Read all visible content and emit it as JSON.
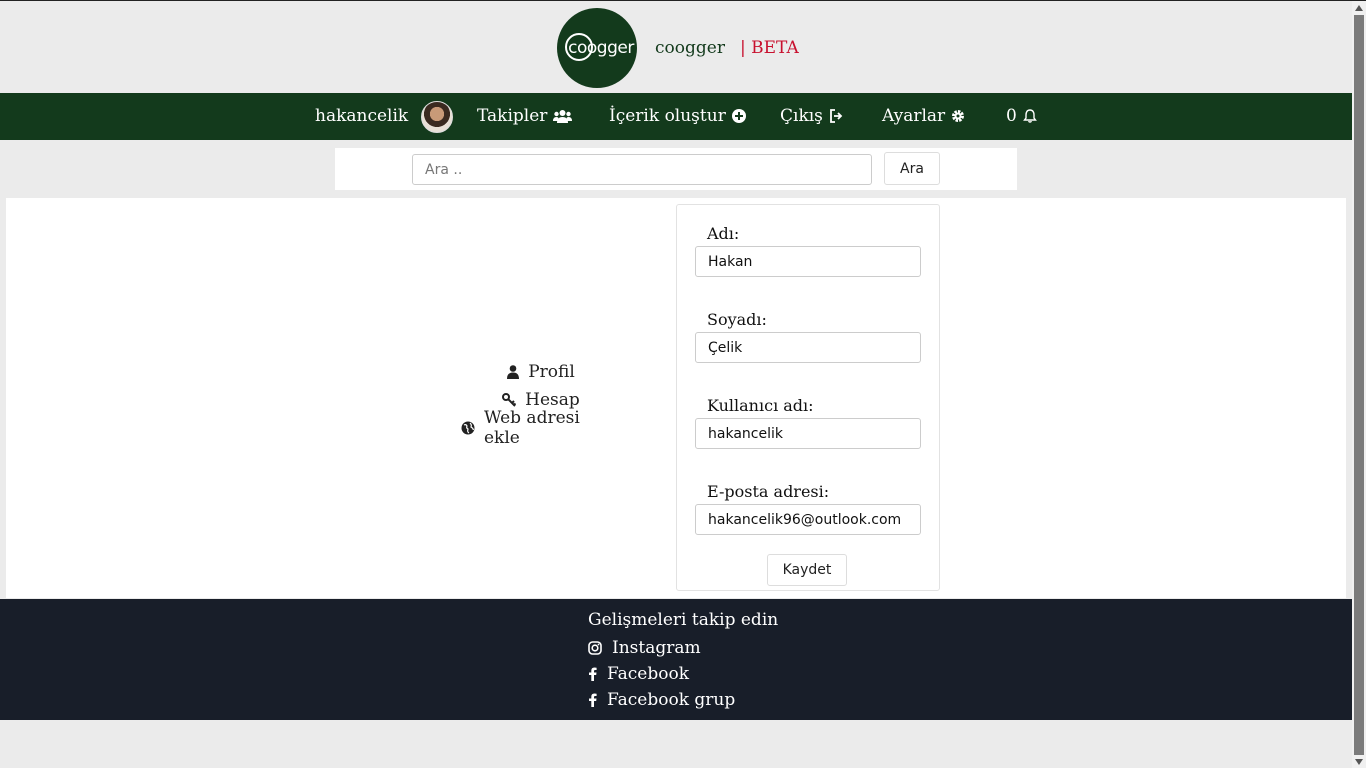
{
  "header": {
    "logo_text": "coogger",
    "brand": "coogger",
    "beta": "| BETA"
  },
  "nav": {
    "username": "hakancelik",
    "followers": "Takipler",
    "create_content": "İçerik oluştur",
    "logout": "Çıkış",
    "settings": "Ayarlar",
    "notification_count": "0"
  },
  "search": {
    "placeholder": "Ara ..",
    "button": "Ara"
  },
  "side_menu": {
    "items": [
      {
        "label": "Profil",
        "icon": "user-icon"
      },
      {
        "label": "Hesap",
        "icon": "key-icon"
      },
      {
        "label": "Web adresi ekle",
        "icon": "globe-icon"
      }
    ]
  },
  "form": {
    "first_name_label": "Adı:",
    "first_name_value": "Hakan",
    "last_name_label": "Soyadı:",
    "last_name_value": "Çelik",
    "username_label": "Kullanıcı adı:",
    "username_value": "hakancelik",
    "email_label": "E-posta adresi:",
    "email_value": "hakancelik96@outlook.com",
    "save_button": "Kaydet"
  },
  "footer": {
    "title": "Gelişmeleri takip edin",
    "links": [
      {
        "label": "Instagram",
        "icon": "instagram-icon"
      },
      {
        "label": "Facebook",
        "icon": "facebook-icon"
      },
      {
        "label": "Facebook grup",
        "icon": "facebook-icon"
      }
    ]
  },
  "colors": {
    "brand_green": "#133a1c",
    "beta_red": "#c8102e",
    "footer_bg": "#181e29",
    "page_bg": "#ebebeb"
  }
}
